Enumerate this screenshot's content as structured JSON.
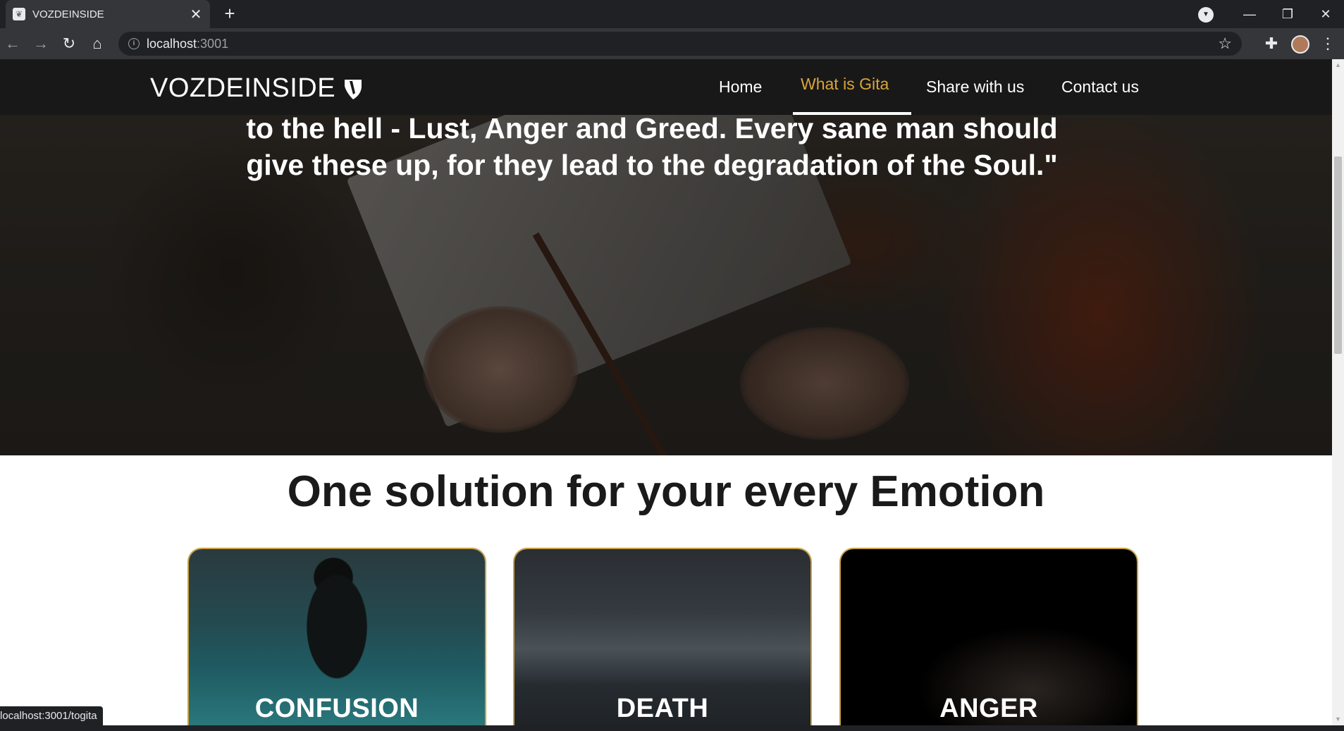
{
  "browser": {
    "tab_title": "VOZDEINSIDE",
    "tab_close": "✕",
    "new_tab": "+",
    "url_host": "localhost",
    "url_port": ":3001",
    "status_url": "localhost:3001/togita"
  },
  "site": {
    "brand": "VOZDEINSIDE",
    "nav": {
      "home": "Home",
      "what_is_gita": "What is Gita",
      "share": "Share with us",
      "contact": "Contact us"
    },
    "active_nav_color": "#d9a53a"
  },
  "hero": {
    "quote_line1": "to the hell - Lust, Anger and Greed. Every sane man should",
    "quote_line2": "give these up, for they lead to the degradation of the Soul.\""
  },
  "emotions": {
    "title": "One solution for your every Emotion",
    "cards": [
      {
        "label": "CONFUSION"
      },
      {
        "label": "DEATH"
      },
      {
        "label": "ANGER"
      }
    ],
    "card_border_color": "#c9a143"
  },
  "icons": {
    "back": "back-arrow-icon",
    "forward": "forward-arrow-icon",
    "reload": "reload-icon",
    "home": "home-icon",
    "info": "info-icon",
    "star": "star-icon",
    "extensions": "puzzle-icon",
    "menu": "kebab-menu-icon"
  }
}
